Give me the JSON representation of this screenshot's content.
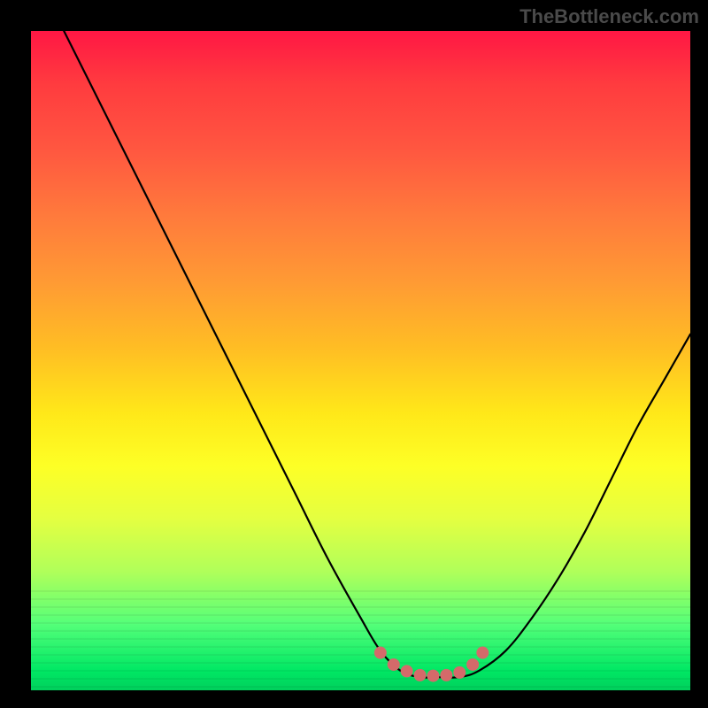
{
  "watermark": "TheBottleneck.com",
  "chart_data": {
    "type": "line",
    "title": "",
    "xlabel": "",
    "ylabel": "",
    "xlim": [
      0,
      100
    ],
    "ylim": [
      0,
      100
    ],
    "series": [
      {
        "name": "bottleneck-curve",
        "x": [
          5,
          10,
          15,
          20,
          25,
          30,
          35,
          40,
          45,
          50,
          53,
          56,
          59,
          62,
          65,
          68,
          72,
          76,
          80,
          84,
          88,
          92,
          96,
          100
        ],
        "values": [
          100,
          90,
          80,
          70,
          60,
          50,
          40,
          30,
          20,
          11,
          6,
          3,
          2,
          2,
          2,
          3,
          6,
          11,
          17,
          24,
          32,
          40,
          47,
          54
        ]
      }
    ],
    "markers": {
      "name": "highlight-dots",
      "x": [
        53,
        55,
        57,
        59,
        61,
        63,
        65,
        67,
        68.5
      ],
      "values": [
        5.7,
        3.9,
        2.9,
        2.3,
        2.2,
        2.3,
        2.7,
        3.9,
        5.7
      ],
      "color": "#d46a6a",
      "radius_px": 7
    },
    "gradient_stops": [
      {
        "pos": 0,
        "color": "#ff1744"
      },
      {
        "pos": 18,
        "color": "#ff5740"
      },
      {
        "pos": 38,
        "color": "#ff9a34"
      },
      {
        "pos": 58,
        "color": "#ffe819"
      },
      {
        "pos": 74,
        "color": "#e4ff41"
      },
      {
        "pos": 90,
        "color": "#54ff79"
      },
      {
        "pos": 100,
        "color": "#00d05c"
      }
    ]
  }
}
